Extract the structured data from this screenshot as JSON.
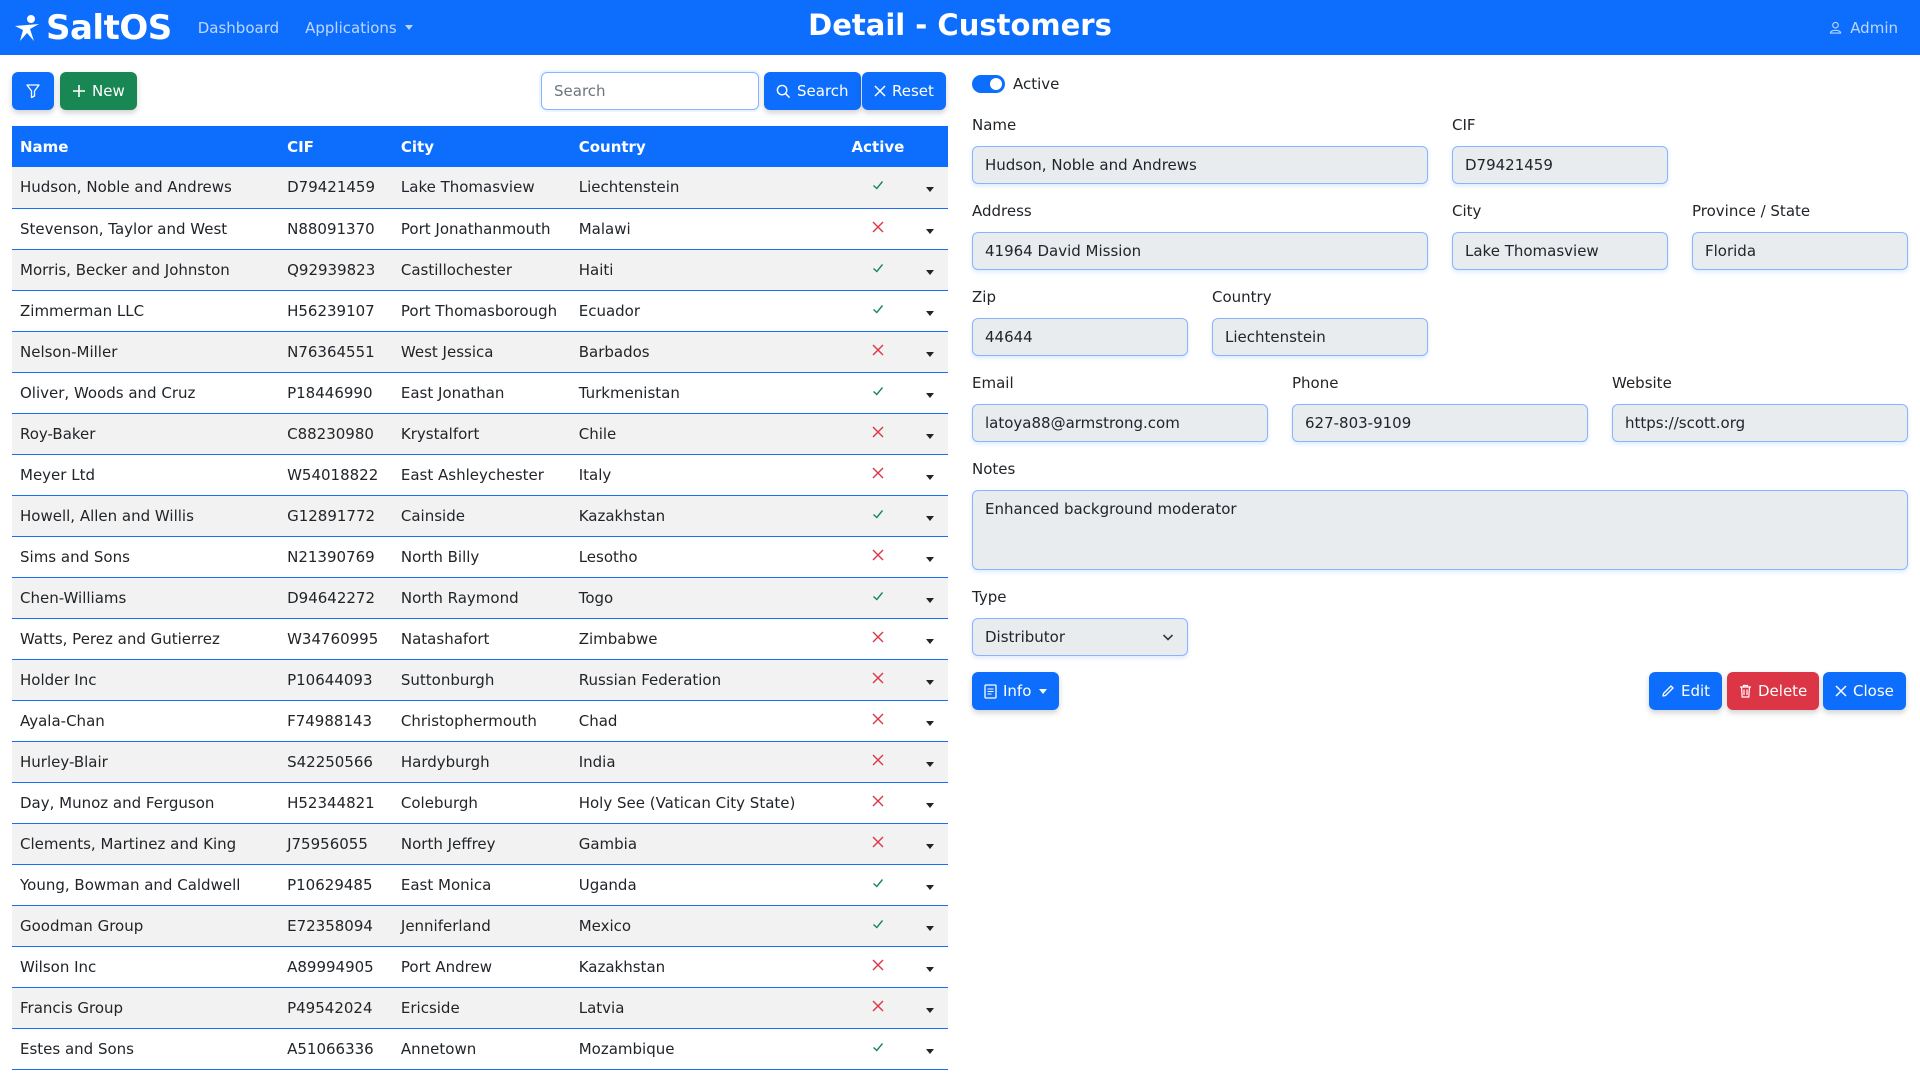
{
  "navbar": {
    "brand": "SaltOS",
    "links": {
      "dashboard": "Dashboard",
      "applications": "Applications"
    },
    "title": "Detail - Customers",
    "user": "Admin"
  },
  "toolbar": {
    "new_label": "New",
    "search_placeholder": "Search",
    "search_label": "Search",
    "reset_label": "Reset"
  },
  "table": {
    "headers": {
      "name": "Name",
      "cif": "CIF",
      "city": "City",
      "country": "Country",
      "active": "Active"
    },
    "rows": [
      {
        "name": "Hudson, Noble and Andrews",
        "cif": "D79421459",
        "city": "Lake Thomasview",
        "country": "Liechtenstein",
        "active": true
      },
      {
        "name": "Stevenson, Taylor and West",
        "cif": "N88091370",
        "city": "Port Jonathanmouth",
        "country": "Malawi",
        "active": false
      },
      {
        "name": "Morris, Becker and Johnston",
        "cif": "Q92939823",
        "city": "Castillochester",
        "country": "Haiti",
        "active": true
      },
      {
        "name": "Zimmerman LLC",
        "cif": "H56239107",
        "city": "Port Thomasborough",
        "country": "Ecuador",
        "active": true
      },
      {
        "name": "Nelson-Miller",
        "cif": "N76364551",
        "city": "West Jessica",
        "country": "Barbados",
        "active": false
      },
      {
        "name": "Oliver, Woods and Cruz",
        "cif": "P18446990",
        "city": "East Jonathan",
        "country": "Turkmenistan",
        "active": true
      },
      {
        "name": "Roy-Baker",
        "cif": "C88230980",
        "city": "Krystalfort",
        "country": "Chile",
        "active": false
      },
      {
        "name": "Meyer Ltd",
        "cif": "W54018822",
        "city": "East Ashleychester",
        "country": "Italy",
        "active": false
      },
      {
        "name": "Howell, Allen and Willis",
        "cif": "G12891772",
        "city": "Cainside",
        "country": "Kazakhstan",
        "active": true
      },
      {
        "name": "Sims and Sons",
        "cif": "N21390769",
        "city": "North Billy",
        "country": "Lesotho",
        "active": false
      },
      {
        "name": "Chen-Williams",
        "cif": "D94642272",
        "city": "North Raymond",
        "country": "Togo",
        "active": true
      },
      {
        "name": "Watts, Perez and Gutierrez",
        "cif": "W34760995",
        "city": "Natashafort",
        "country": "Zimbabwe",
        "active": false
      },
      {
        "name": "Holder Inc",
        "cif": "P10644093",
        "city": "Suttonburgh",
        "country": "Russian Federation",
        "active": false
      },
      {
        "name": "Ayala-Chan",
        "cif": "F74988143",
        "city": "Christophermouth",
        "country": "Chad",
        "active": false
      },
      {
        "name": "Hurley-Blair",
        "cif": "S42250566",
        "city": "Hardyburgh",
        "country": "India",
        "active": false
      },
      {
        "name": "Day, Munoz and Ferguson",
        "cif": "H52344821",
        "city": "Coleburgh",
        "country": "Holy See (Vatican City State)",
        "active": false
      },
      {
        "name": "Clements, Martinez and King",
        "cif": "J75956055",
        "city": "North Jeffrey",
        "country": "Gambia",
        "active": false
      },
      {
        "name": "Young, Bowman and Caldwell",
        "cif": "P10629485",
        "city": "East Monica",
        "country": "Uganda",
        "active": true
      },
      {
        "name": "Goodman Group",
        "cif": "E72358094",
        "city": "Jenniferland",
        "country": "Mexico",
        "active": true
      },
      {
        "name": "Wilson Inc",
        "cif": "A89994905",
        "city": "Port Andrew",
        "country": "Kazakhstan",
        "active": false
      },
      {
        "name": "Francis Group",
        "cif": "P49542024",
        "city": "Ericside",
        "country": "Latvia",
        "active": false
      },
      {
        "name": "Estes and Sons",
        "cif": "A51066336",
        "city": "Annetown",
        "country": "Mozambique",
        "active": true
      }
    ]
  },
  "detail": {
    "active_label": "Active",
    "labels": {
      "name": "Name",
      "cif": "CIF",
      "address": "Address",
      "city": "City",
      "province": "Province / State",
      "zip": "Zip",
      "country": "Country",
      "email": "Email",
      "phone": "Phone",
      "website": "Website",
      "notes": "Notes",
      "type": "Type"
    },
    "values": {
      "name": "Hudson, Noble and Andrews",
      "cif": "D79421459",
      "address": "41964 David Mission",
      "city": "Lake Thomasview",
      "province": "Florida",
      "zip": "44644",
      "country": "Liechtenstein",
      "email": "latoya88@armstrong.com",
      "phone": "627-803-9109",
      "website": "https://scott.org",
      "notes": "Enhanced background moderator",
      "type": "Distributor"
    },
    "buttons": {
      "info": "Info",
      "edit": "Edit",
      "delete": "Delete",
      "close": "Close"
    }
  },
  "colors": {
    "primary": "#0d6efd",
    "success": "#198754",
    "danger": "#dc3545",
    "check": "#198754",
    "cross": "#dc3545"
  }
}
